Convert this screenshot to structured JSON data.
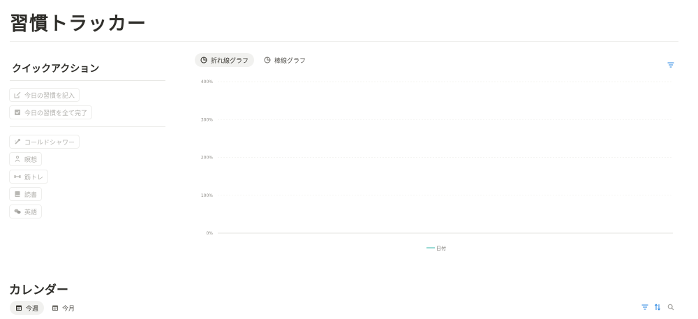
{
  "page": {
    "title": "習慣トラッカー"
  },
  "quick_actions": {
    "heading": "クイックアクション",
    "top_buttons": [
      {
        "label": "今日の習慣を記入",
        "icon": "edit-icon"
      },
      {
        "label": "今日の習慣を全て完了",
        "icon": "checkbox-icon"
      }
    ],
    "habit_buttons": [
      {
        "label": "コールドシャワー",
        "icon": "shower-icon"
      },
      {
        "label": "瞑想",
        "icon": "meditation-icon"
      },
      {
        "label": "筋トレ",
        "icon": "dumbbell-icon"
      },
      {
        "label": "読書",
        "icon": "book-icon"
      },
      {
        "label": "英語",
        "icon": "speech-bubbles-icon"
      }
    ]
  },
  "chart_view": {
    "tabs": [
      {
        "label": "折れ線グラフ",
        "icon": "chart-icon",
        "active": true
      },
      {
        "label": "棒線グラフ",
        "icon": "chart-icon",
        "active": false
      }
    ],
    "accent_color": "#2383e2"
  },
  "chart_data": {
    "type": "line",
    "y_ticks": [
      "0%",
      "100%",
      "200%",
      "300%",
      "400%"
    ],
    "ylim": [
      0,
      400
    ],
    "x": [],
    "series": [
      {
        "name": "日付",
        "values": [],
        "color": "#55c2b8"
      }
    ],
    "grid": true,
    "legend": "bottom-center"
  },
  "calendar": {
    "heading": "カレンダー",
    "tabs": [
      {
        "label": "今週",
        "icon": "calendar-icon",
        "active": true
      },
      {
        "label": "今月",
        "icon": "calendar-icon",
        "active": false
      }
    ],
    "toolbar": [
      {
        "icon": "filter-icon",
        "color": "#2383e2"
      },
      {
        "icon": "sort-icon",
        "color": "#2383e2"
      },
      {
        "icon": "search-icon",
        "color": "#9b9a97"
      }
    ]
  }
}
